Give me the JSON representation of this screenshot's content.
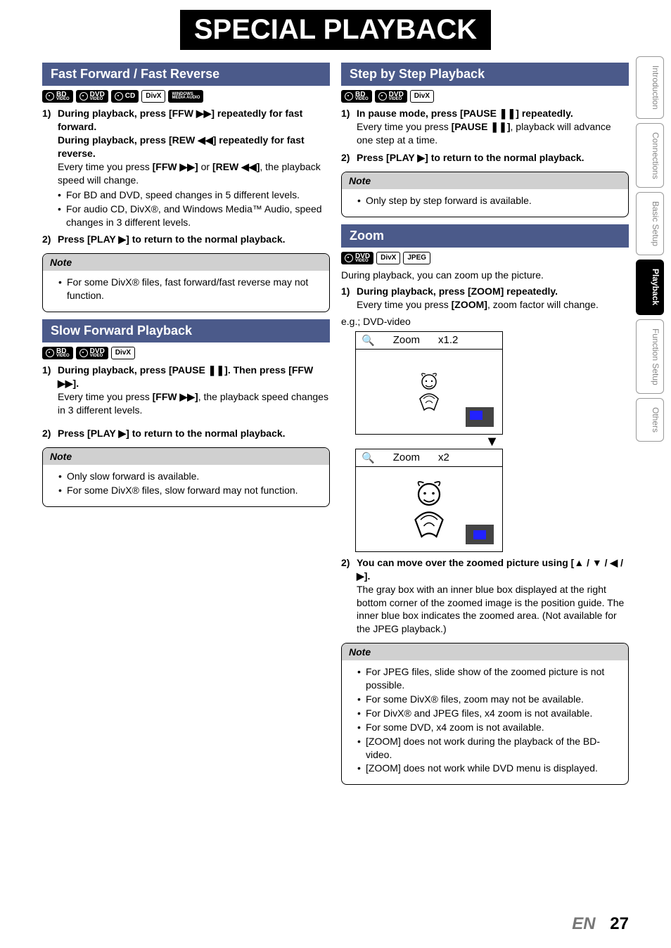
{
  "page": {
    "title": "SPECIAL PLAYBACK",
    "lang": "EN",
    "number": "27"
  },
  "tabs": [
    "Introduction",
    "Connections",
    "Basic Setup",
    "Playback",
    "Function Setup",
    "Others"
  ],
  "tabs_active_index": 3,
  "icons": {
    "ffw": "▶▶",
    "rew": "◀◀",
    "play": "▶",
    "pause": "❚❚",
    "arrows": "▲ / ▼ / ◀ / ▶"
  },
  "sections": {
    "ffrev": {
      "title": "Fast Forward / Fast Reverse",
      "badges": [
        "BD VIDEO",
        "DVD VIDEO",
        "CD",
        "DivX",
        "WINDOWS MEDIA AUDIO"
      ],
      "step1_a": "During playback, press [FFW ",
      "step1_b": "] repeatedly for fast forward.",
      "step1c_a": "During playback, press [REW ",
      "step1c_b": "] repeatedly for fast reverse.",
      "step1d_a": "Every time you press ",
      "step1d_b": "[FFW ",
      "step1d_c": "]",
      "step1d_d": " or ",
      "step1d_e": "[REW ",
      "step1d_f": "]",
      "step1d_g": ", the playback speed will change.",
      "bullets": [
        "For BD and DVD, speed changes in 5 different levels.",
        "For audio CD, DivX®, and Windows Media™ Audio, speed changes in 3 different levels."
      ],
      "step2_a": "Press [PLAY ",
      "step2_b": "] to return to the normal playback.",
      "note_title": "Note",
      "note_items": [
        "For some DivX® files, fast forward/fast reverse may not function."
      ]
    },
    "slow": {
      "title": "Slow Forward Playback",
      "badges": [
        "BD VIDEO",
        "DVD VIDEO",
        "DivX"
      ],
      "step1_a": "During playback, press [PAUSE ",
      "step1_b": "]. Then press [FFW ",
      "step1_c": "].",
      "step1d_a": "Every time you press ",
      "step1d_b": "[FFW ",
      "step1d_c": "]",
      "step1d_d": ", the playback speed changes in 3 different levels.",
      "step2_a": "Press [PLAY ",
      "step2_b": "] to return to the normal playback.",
      "note_title": "Note",
      "note_items": [
        "Only slow forward is available.",
        "For some DivX® files, slow forward may not function."
      ]
    },
    "step": {
      "title": "Step by Step Playback",
      "badges": [
        "BD VIDEO",
        "DVD VIDEO",
        "DivX"
      ],
      "step1_a": "In pause mode, press [PAUSE ",
      "step1_b": "] repeatedly.",
      "step1c_a": "Every time you press ",
      "step1c_b": "[PAUSE ",
      "step1c_c": "]",
      "step1c_d": ", playback will advance one step at a time.",
      "step2_a": "Press [PLAY ",
      "step2_b": "] to return to the normal playback.",
      "note_title": "Note",
      "note_items": [
        "Only step by step forward is available."
      ]
    },
    "zoom": {
      "title": "Zoom",
      "badges": [
        "DVD VIDEO",
        "DivX",
        "JPEG"
      ],
      "intro": "During playback, you can zoom up the picture.",
      "step1_a": "During playback, press [ZOOM] repeatedly.",
      "step1_b_a": "Every time you press ",
      "step1_b_b": "[ZOOM]",
      "step1_b_c": ", zoom factor will change.",
      "eg": "e.g.; DVD-video",
      "zoom1_label": "Zoom",
      "zoom1_factor": "x1.2",
      "zoom2_label": "Zoom",
      "zoom2_factor": "x2",
      "step2_a": "You can move over the zoomed picture using [",
      "step2_b": "].",
      "step2_desc": "The gray box with an inner blue box displayed at the right bottom corner of the zoomed image is the position guide. The inner blue box indicates the zoomed area. (Not available for the JPEG playback.)",
      "note_title": "Note",
      "note_items": [
        "For JPEG files, slide show of the zoomed picture is not possible.",
        "For some DivX® files, zoom may not be available.",
        "For DivX® and JPEG files, x4 zoom is not available.",
        "For some DVD, x4 zoom is not available.",
        "[ZOOM] does not work during the playback of the BD-video.",
        "[ZOOM] does not work while DVD menu is displayed."
      ]
    }
  }
}
